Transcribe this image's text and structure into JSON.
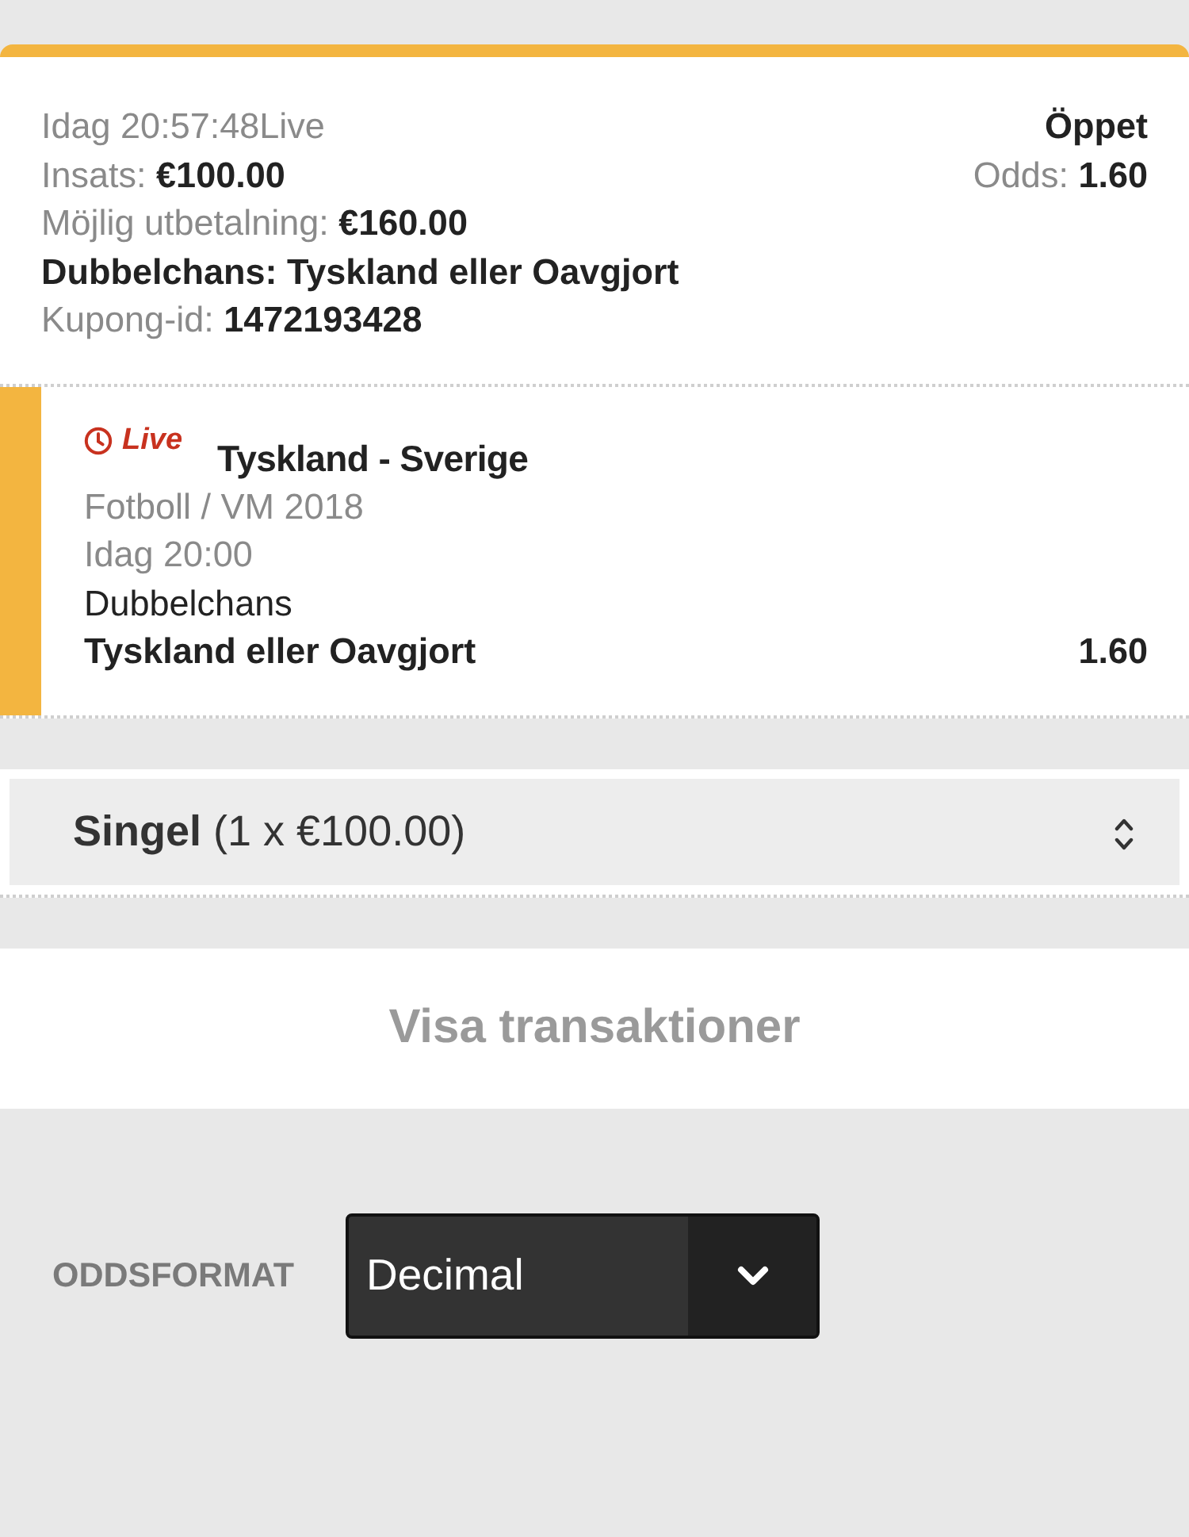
{
  "coupon": {
    "placed": "Idag 20:57:48Live",
    "status": "Öppet",
    "stake": "Insats: **€100.00**",
    "odds": "Odds: **1.60**",
    "payout": "Möjlig utbetalning: **€160.00**",
    "market_title": "Dubbelchans: Tyskland eller Oavgjort",
    "coupon_id": "Kupong-id: **1472193428**"
  },
  "selection": {
    "live_label": "Live",
    "event": "Tyskland - Sverige",
    "league": "Fotboll / VM 2018",
    "start": "Idag 20:00",
    "market": "Dubbelchans",
    "pick": "Tyskland eller Oavgjort",
    "odds": "1.60"
  },
  "bet_type": {
    "value": "**Singel** (1 x €100.00)"
  },
  "transactions_button": "Visa transaktioner",
  "odds_format": {
    "label": "ODDSFORMAT",
    "value": "Decimal"
  }
}
